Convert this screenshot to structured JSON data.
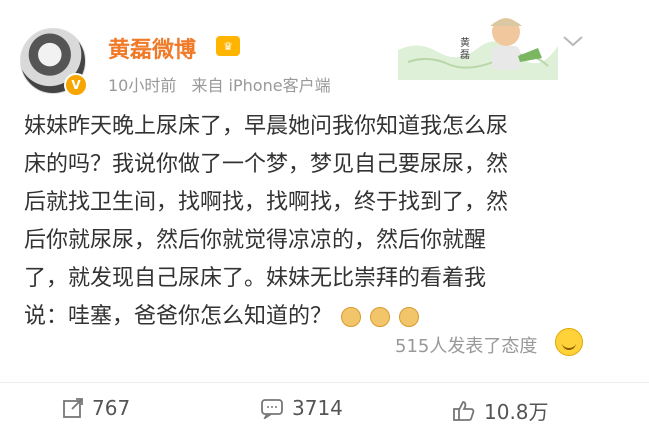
{
  "post": {
    "username": "黄磊微博",
    "time": "10小时前",
    "source": "来自 iPhone客户端",
    "member_badge": "♛",
    "v_badge": "V",
    "text_lines": [
      "妹妹昨天晚上尿床了，早晨她问我你知道我怎么尿",
      "床的吗？我说你做了一个梦，梦见自己要尿尿，然",
      "后就找卫生间，找啊找，找啊找，终于找到了，然",
      "后你就尿尿，然后你就觉得凉凉的，然后你就醒",
      "了，就发现自己尿床了。妹妹无比崇拜的看着我",
      "说：哇塞，爸爸你怎么知道的？"
    ],
    "attitude_text": "515人发表了态度",
    "icons": {
      "chevron": "chevron-down-icon",
      "share": "share-icon",
      "comment": "comment-icon",
      "like": "thumbs-up-icon",
      "emoji": "laughing-emoji-icon"
    }
  },
  "actions": {
    "share_count": "767",
    "comment_count": "3714",
    "like_count": "10.8万"
  },
  "colors": {
    "username": "#f17a29",
    "meta": "#999999",
    "text": "#333333",
    "divider": "#ececec"
  }
}
